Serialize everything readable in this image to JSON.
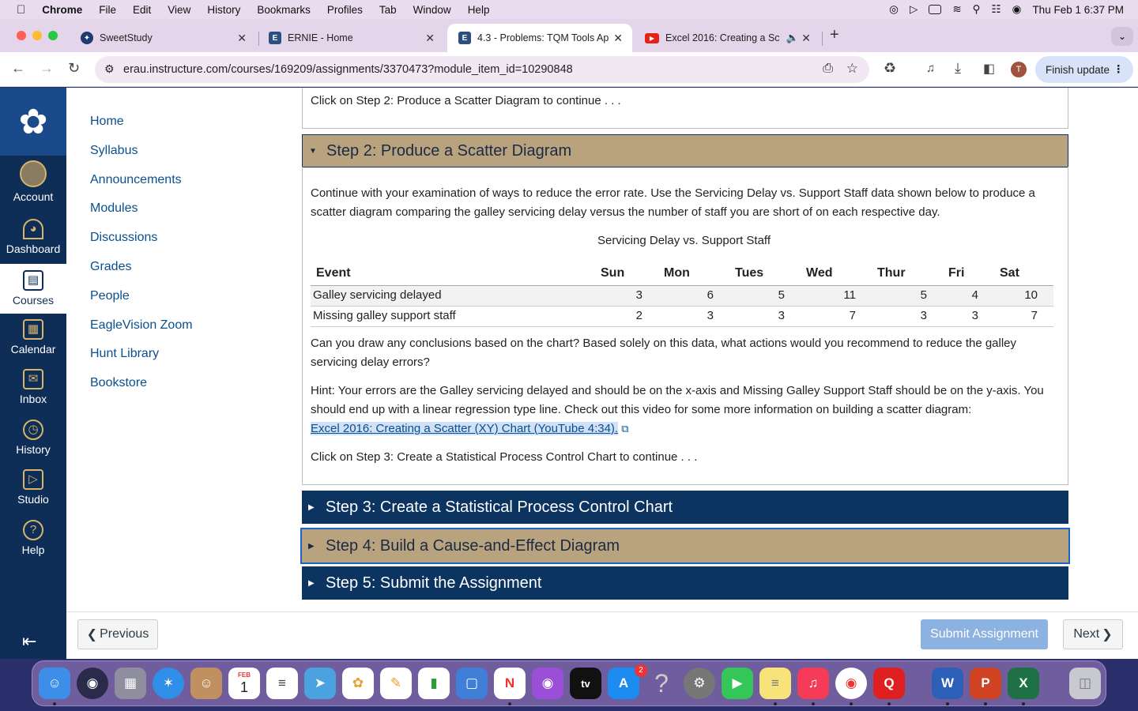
{
  "menubar": {
    "app": "Chrome",
    "items": [
      "File",
      "Edit",
      "View",
      "History",
      "Bookmarks",
      "Profiles",
      "Tab",
      "Window",
      "Help"
    ],
    "clock": "Thu Feb 1  6:37 PM"
  },
  "tabs": [
    {
      "title": "SweetStudy",
      "icon": "sweetstudy-icon"
    },
    {
      "title": "ERNIE - Home",
      "icon": "canvas-e-icon"
    },
    {
      "title": "4.3 - Problems: TQM Tools Ap",
      "icon": "canvas-e-icon"
    },
    {
      "title": "Excel 2016: Creating a Sc",
      "icon": "youtube-icon"
    }
  ],
  "address": "erau.instructure.com/courses/169209/assignments/3370473?module_item_id=10290848",
  "profile_initial": "T",
  "finish_update": "Finish update",
  "globalnav": [
    {
      "label": "Account",
      "icon": "avatar"
    },
    {
      "label": "Dashboard",
      "icon": "dashboard-icon"
    },
    {
      "label": "Courses",
      "icon": "courses-icon"
    },
    {
      "label": "Calendar",
      "icon": "calendar-icon"
    },
    {
      "label": "Inbox",
      "icon": "inbox-icon"
    },
    {
      "label": "History",
      "icon": "history-icon"
    },
    {
      "label": "Studio",
      "icon": "studio-icon"
    },
    {
      "label": "Help",
      "icon": "help-icon"
    }
  ],
  "coursenav": [
    "Home",
    "Syllabus",
    "Announcements",
    "Modules",
    "Discussions",
    "Grades",
    "People",
    "EagleVision Zoom",
    "Hunt Library",
    "Bookstore"
  ],
  "content": {
    "prev_text": "Click on Step 2: Produce a Scatter Diagram to continue . . .",
    "step2_title": "Step 2: Produce a Scatter Diagram",
    "intro": "Continue with your examination of ways to reduce the error rate. Use the Servicing Delay vs. Support Staff data shown below to produce a scatter diagram comparing the galley servicing delay versus the number of staff you are short of on each respective day.",
    "table_caption": "Servicing Delay vs. Support Staff",
    "table": {
      "headers": [
        "Event",
        "Sun",
        "Mon",
        "Tues",
        "Wed",
        "Thur",
        "Fri",
        "Sat"
      ],
      "rows": [
        [
          "Galley servicing delayed",
          "3",
          "6",
          "5",
          "11",
          "5",
          "4",
          "10"
        ],
        [
          "Missing galley support staff",
          "2",
          "3",
          "3",
          "7",
          "3",
          "3",
          "7"
        ]
      ]
    },
    "question": "Can you draw any conclusions based on the chart? Based solely on this data, what actions would you recommend to reduce the galley servicing delay errors?",
    "hint": "Hint: Your errors are the Galley servicing delayed and should be on the x-axis and Missing Galley Support Staff should be on the y-axis. You should end up with a linear regression type line. Check out this video for some more information on building a scatter diagram:",
    "link": "Excel 2016: Creating a Scatter (XY) Chart (YouTube 4:34).",
    "continue": "Click on Step 3: Create a Statistical Process Control Chart to continue . . .",
    "step3_title": "Step 3: Create a Statistical Process Control Chart",
    "step4_title": "Step 4: Build a Cause-and-Effect Diagram",
    "step5_title": "Step 5: Submit the Assignment"
  },
  "footer": {
    "previous": "Previous",
    "submit": "Submit Assignment",
    "next": "Next"
  },
  "dock_badge": "2",
  "calendar_icon": {
    "month": "FEB",
    "day": "1"
  },
  "colors": {
    "canvas_navy": "#0c3461",
    "step_gold": "#b9a37e",
    "link_blue": "#0a4f8f"
  }
}
